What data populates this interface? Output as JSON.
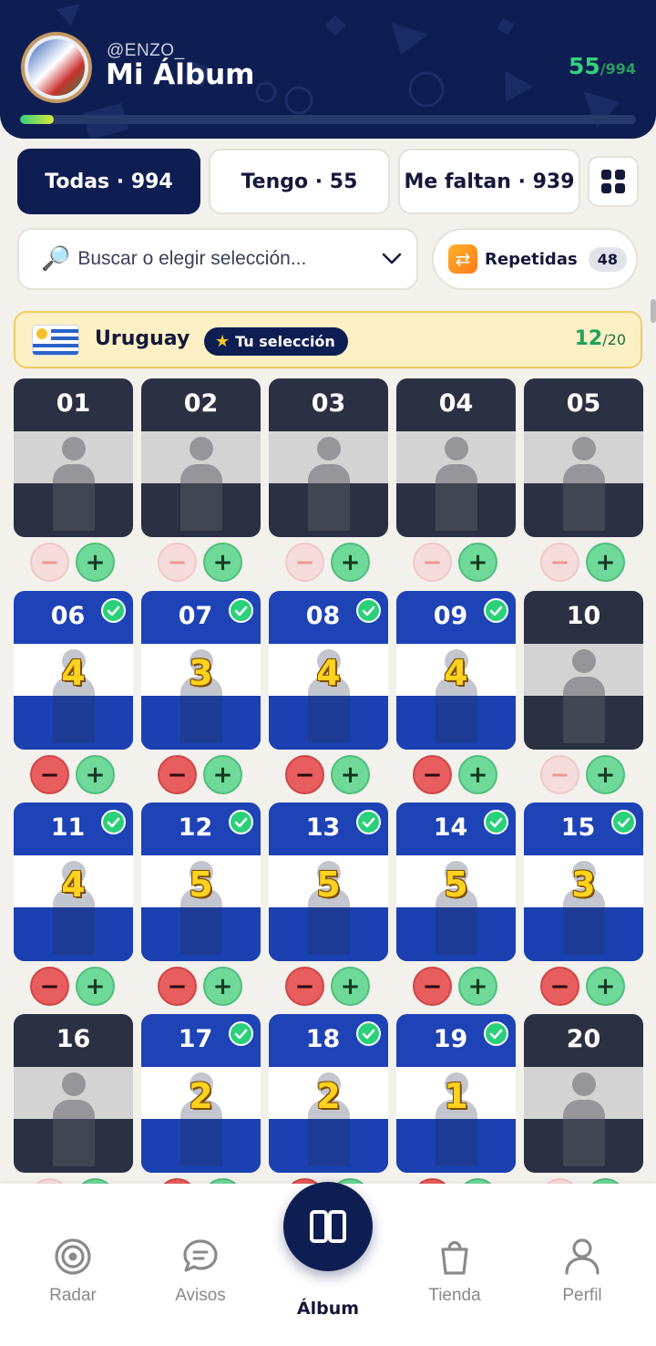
{
  "header": {
    "handle": "@ENZO_",
    "title": "Mi Álbum",
    "count_have": "55",
    "count_total": "/994",
    "progress_fraction": 0.055
  },
  "filters": {
    "tabs": [
      {
        "label": "Todas · 994",
        "active": true
      },
      {
        "label": "Tengo · 55",
        "active": false
      },
      {
        "label": "Me faltan · 939",
        "active": false
      }
    ],
    "grid_icon": "grid-icon"
  },
  "search": {
    "placeholder": "Buscar o elegir selección...",
    "icon": "magnifier-icon",
    "dropdown_icon": "chevron-down-icon"
  },
  "repeated": {
    "label": "Repetidas",
    "count": "48",
    "icon": "swap-arrows-icon"
  },
  "team": {
    "name": "Uruguay",
    "badge": "Tu selección",
    "have": "12",
    "total": "/20"
  },
  "stickers": [
    {
      "num": "01",
      "owned": false,
      "qty": ""
    },
    {
      "num": "02",
      "owned": false,
      "qty": ""
    },
    {
      "num": "03",
      "owned": false,
      "qty": ""
    },
    {
      "num": "04",
      "owned": false,
      "qty": ""
    },
    {
      "num": "05",
      "owned": false,
      "qty": ""
    },
    {
      "num": "06",
      "owned": true,
      "qty": "4"
    },
    {
      "num": "07",
      "owned": true,
      "qty": "3"
    },
    {
      "num": "08",
      "owned": true,
      "qty": "4"
    },
    {
      "num": "09",
      "owned": true,
      "qty": "4"
    },
    {
      "num": "10",
      "owned": false,
      "qty": ""
    },
    {
      "num": "11",
      "owned": true,
      "qty": "4"
    },
    {
      "num": "12",
      "owned": true,
      "qty": "5"
    },
    {
      "num": "13",
      "owned": true,
      "qty": "5"
    },
    {
      "num": "14",
      "owned": true,
      "qty": "5"
    },
    {
      "num": "15",
      "owned": true,
      "qty": "3"
    },
    {
      "num": "16",
      "owned": false,
      "qty": ""
    },
    {
      "num": "17",
      "owned": true,
      "qty": "2"
    },
    {
      "num": "18",
      "owned": true,
      "qty": "2"
    },
    {
      "num": "19",
      "owned": true,
      "qty": "1"
    },
    {
      "num": "20",
      "owned": false,
      "qty": ""
    }
  ],
  "nav": {
    "items": [
      {
        "label": "Radar",
        "icon": "radar-icon"
      },
      {
        "label": "Avisos",
        "icon": "chat-bubble-icon"
      },
      {
        "label": "Álbum",
        "icon": "album-book-icon"
      },
      {
        "label": "Tienda",
        "icon": "shopping-bag-icon"
      },
      {
        "label": "Perfil",
        "icon": "user-icon"
      }
    ]
  },
  "colors": {
    "navy": "#0f1e52",
    "green": "#36d07d",
    "owned_blue": "#1e43b7",
    "missing_dark": "#2b3042",
    "banner_yellow": "#fdf0c4"
  }
}
